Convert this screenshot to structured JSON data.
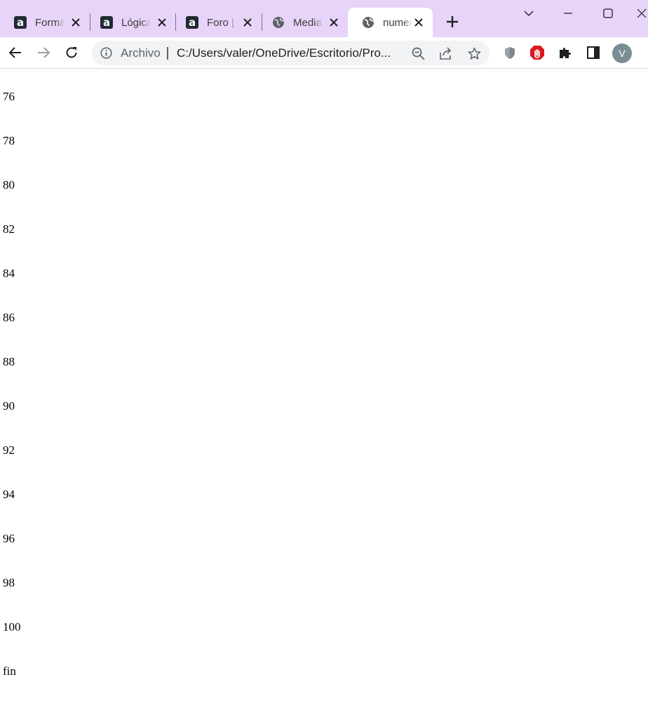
{
  "tabs": [
    {
      "title": "Forma",
      "favicon": "alura-icon"
    },
    {
      "title": "Lógica",
      "favicon": "alura-icon"
    },
    {
      "title": "Foro |",
      "favicon": "alura-icon"
    },
    {
      "title": "Media",
      "favicon": "globe-icon"
    },
    {
      "title": "numer",
      "favicon": "globe-icon",
      "active": true
    }
  ],
  "toolbar": {
    "site_info_label": "Archivo",
    "url": "C:/Users/valer/OneDrive/Escritorio/Pro...",
    "avatar_letter": "V"
  },
  "colors": {
    "tabstrip": "#e7d4f8",
    "active_tab": "#ffffff",
    "omnibox": "#f1f3f4",
    "avatar": "#7b8d94",
    "adblock": "#e0161d"
  },
  "content": {
    "lines": [
      "76",
      "78",
      "80",
      "82",
      "84",
      "86",
      "88",
      "90",
      "92",
      "94",
      "96",
      "98",
      "100",
      "fin"
    ]
  }
}
